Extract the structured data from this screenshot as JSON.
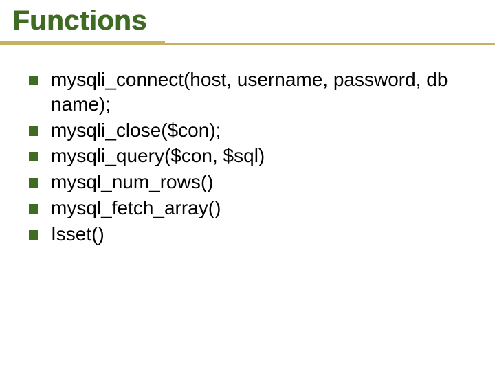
{
  "title": "Functions",
  "items": [
    "mysqli_connect(host, username, password, db name);",
    "mysqli_close($con);",
    "mysqli_query($con, $sql)",
    "mysql_num_rows()",
    "mysql_fetch_array()",
    "Isset()"
  ]
}
